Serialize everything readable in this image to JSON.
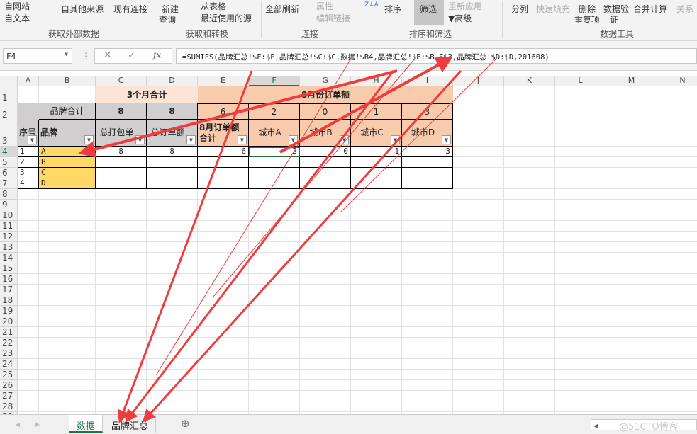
{
  "ribbon": {
    "from_web": "自网站",
    "from_text": "自文本",
    "other_sources": "自其他来源",
    "existing": "现有连接",
    "group_external": "获取外部数据",
    "new_query_1": "新建",
    "new_query_2": "查询",
    "from_table": "从表格",
    "recent_sources": "最近使用的源",
    "group_transform": "获取和转换",
    "refresh_all": "全部刷新",
    "properties": "属性",
    "edit_links": "编辑链接",
    "group_connections": "连接",
    "sort": "排序",
    "filter": "筛选",
    "reapply": "重新应用",
    "advanced": "高级",
    "group_sort": "排序和筛选",
    "text_to_columns": "分列",
    "flash_fill": "快速填充",
    "remove_dup_1": "删除",
    "remove_dup_2": "重复项",
    "validation_1": "数据验",
    "validation_2": "证",
    "consolidate": "合并计算",
    "relationships": "关系",
    "group_tools": "数据工具"
  },
  "formula_bar": {
    "name_box": "F4",
    "formula": "=SUMIFS(品牌汇总!$F:$F,品牌汇总!$C:$C,数据!$B4,品牌汇总!$B:$B,F$3,品牌汇总!$D:$D,201608)"
  },
  "columns": [
    "A",
    "B",
    "C",
    "D",
    "E",
    "F",
    "G",
    "H",
    "I",
    "J",
    "K",
    "L",
    "M",
    "N"
  ],
  "selected_cell": "F4",
  "sheet": {
    "row1": {
      "c_d": "3个月合计",
      "e_i": "8月份订单额"
    },
    "row2": {
      "b": "品牌合计",
      "c": "8",
      "d": "8",
      "e": "6",
      "f": "2",
      "g": "0",
      "h": "1",
      "i": "3"
    },
    "row3": {
      "a": "序号",
      "b": "品牌",
      "c": "总打包单",
      "d": "总订单额",
      "e": "8月订单额合计",
      "f": "城市A",
      "g": "城市B",
      "h": "城市C",
      "i": "城市D"
    },
    "data_rows": [
      {
        "a": "1",
        "b": "A",
        "c": "8",
        "d": "8",
        "e": "6",
        "f": "2",
        "g": "0",
        "h": "1",
        "i": "3"
      },
      {
        "a": "2",
        "b": "B"
      },
      {
        "a": "3",
        "b": "C"
      },
      {
        "a": "4",
        "b": "D"
      }
    ]
  },
  "tabs": [
    {
      "label": "数据",
      "active": true
    },
    {
      "label": "品牌汇总",
      "active": false
    }
  ],
  "watermark": "@51CTO博客",
  "colors": {
    "peach_light": "#fce4d6",
    "peach": "#f8cbad",
    "gray": "#d0cece",
    "yellow": "#ffd966",
    "accent": "#217346",
    "arrow": "#f03c3c"
  }
}
